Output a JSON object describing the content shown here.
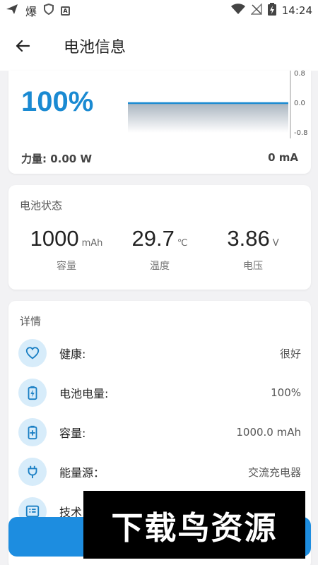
{
  "status_bar": {
    "time": "14:24",
    "app_icon_text": "爆",
    "icons": [
      "send-icon",
      "shield-icon",
      "a-icon",
      "wifi-icon",
      "no-signal-icon",
      "battery-icon"
    ]
  },
  "header": {
    "title": "电池信息",
    "back_icon": "arrow-left-icon"
  },
  "charge_card": {
    "percent": "100%",
    "chart_data": {
      "type": "line",
      "series": [
        {
          "values": [
            0,
            0,
            0,
            0,
            0,
            0,
            0,
            0
          ]
        }
      ],
      "yticks": [
        "0.8",
        "0.0",
        "-0.8"
      ],
      "ylim": [
        -0.8,
        0.8
      ],
      "color": "#1a8ad2"
    },
    "power_label": "力量: 0.00 W",
    "current_label": "0 mA"
  },
  "status_card": {
    "title": "电池状态",
    "stats": [
      {
        "value": "1000",
        "unit": "mAh",
        "label": "容量"
      },
      {
        "value": "29.7",
        "unit": "℃",
        "label": "温度"
      },
      {
        "value": "3.86",
        "unit": "V",
        "label": "电压"
      }
    ]
  },
  "details_card": {
    "title": "详情",
    "rows": [
      {
        "icon": "heart-icon",
        "label": "健康:",
        "value": "很好"
      },
      {
        "icon": "battery-charge-icon",
        "label": "电池电量:",
        "value": "100%"
      },
      {
        "icon": "battery-plus-icon",
        "label": "容量:",
        "value": "1000.0 mAh"
      },
      {
        "icon": "plug-icon",
        "label": "能量源：",
        "value": "交流充电器"
      },
      {
        "icon": "list-icon",
        "label": "技术",
        "value": ""
      }
    ]
  },
  "watermark": "下载鸟资源",
  "colors": {
    "accent": "#1a8ad2",
    "icon_bg": "#d7ecfa",
    "button": "#1d8de0"
  }
}
